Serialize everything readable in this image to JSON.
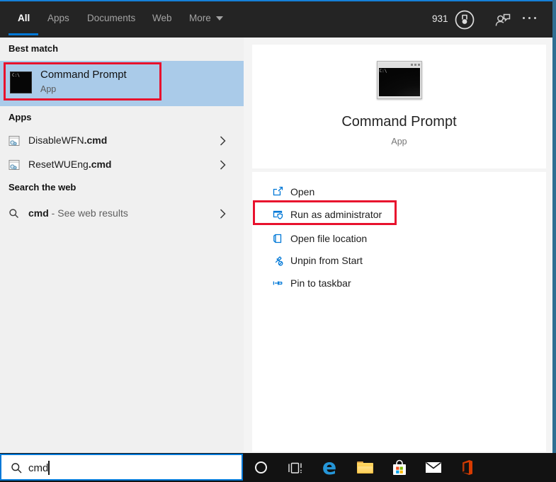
{
  "colors": {
    "accent": "#0078d7",
    "annotation_red": "#e8112d",
    "selection_blue": "#aacbe9",
    "topbar_bg": "#242424",
    "taskbar_bg": "#121212"
  },
  "topbar": {
    "tabs": [
      {
        "label": "All",
        "active": true
      },
      {
        "label": "Apps",
        "active": false
      },
      {
        "label": "Documents",
        "active": false
      },
      {
        "label": "Web",
        "active": false
      },
      {
        "label": "More",
        "active": false,
        "has_dropdown": true
      }
    ],
    "rewards_count": "931"
  },
  "left_panel": {
    "best_match": {
      "header": "Best match",
      "item": {
        "title": "Command Prompt",
        "subtitle": "App",
        "icon_text": "C:\\"
      }
    },
    "apps": {
      "header": "Apps",
      "items": [
        {
          "name": "DisableWFN",
          "match": ".cmd"
        },
        {
          "name": "ResetWUEng",
          "match": ".cmd"
        }
      ]
    },
    "web": {
      "header": "Search the web",
      "item": {
        "query": "cmd",
        "suffix": " - See web results"
      }
    }
  },
  "preview": {
    "title": "Command Prompt",
    "subtitle": "App",
    "icon_text": "C:\\",
    "actions": [
      {
        "label": "Open",
        "icon": "open-window-icon",
        "highlighted": false
      },
      {
        "label": "Run as administrator",
        "icon": "admin-shield-icon",
        "highlighted": true
      },
      {
        "label": "Open file location",
        "icon": "file-location-icon",
        "highlighted": false
      },
      {
        "label": "Unpin from Start",
        "icon": "unpin-icon",
        "highlighted": false
      },
      {
        "label": "Pin to taskbar",
        "icon": "pin-icon",
        "highlighted": false
      }
    ]
  },
  "search": {
    "value": "cmd"
  },
  "taskbar": {
    "edge_glyph": "e",
    "icons": [
      "cortana-icon",
      "task-view-icon",
      "edge-icon",
      "file-explorer-icon",
      "store-icon",
      "mail-icon",
      "office-icon"
    ]
  }
}
